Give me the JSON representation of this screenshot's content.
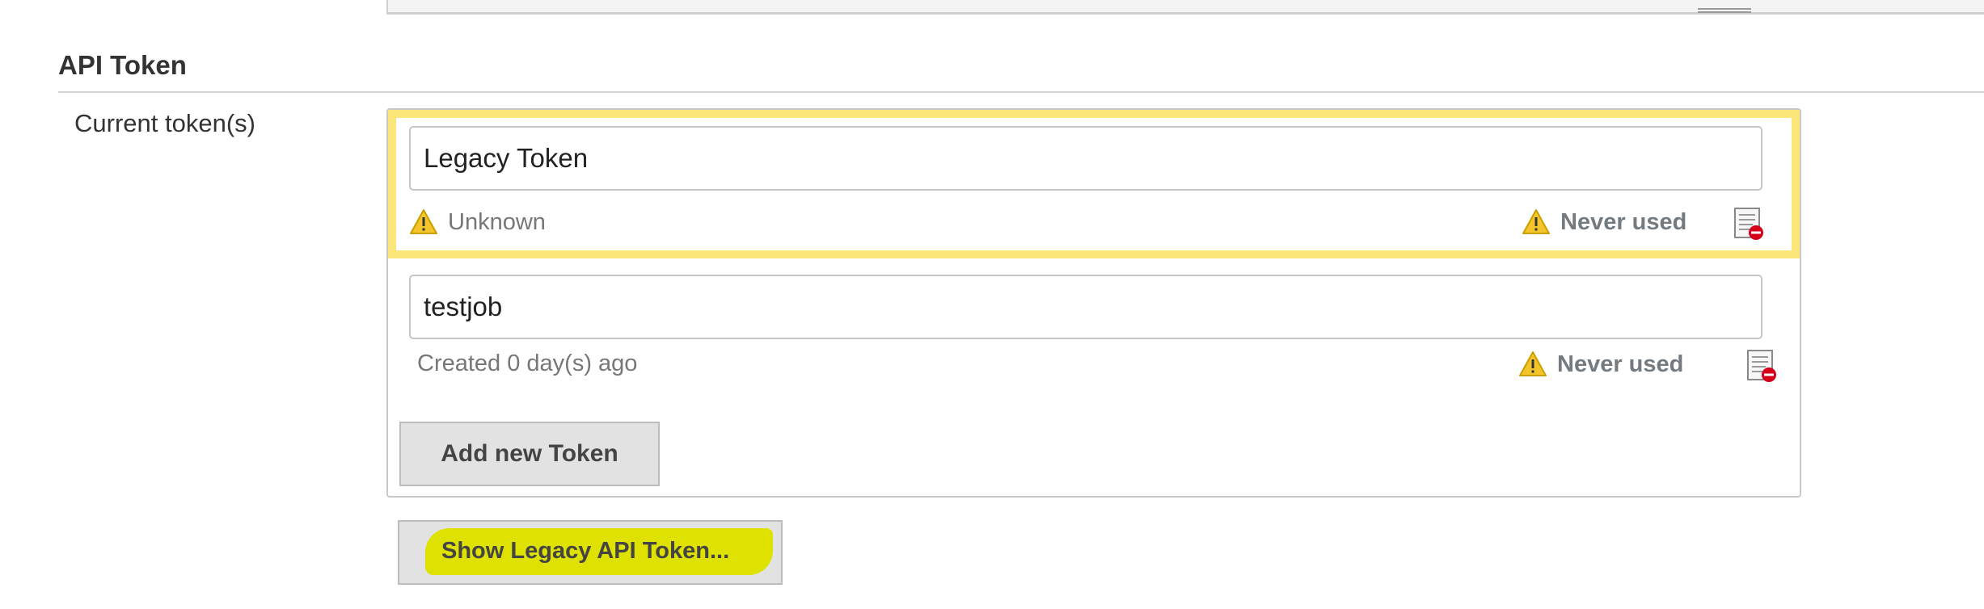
{
  "section": {
    "title": "API Token"
  },
  "field": {
    "label": "Current token(s)"
  },
  "tokens": [
    {
      "name": "Legacy Token",
      "status_text": "Unknown",
      "status_has_warning": true,
      "usage": "Never used",
      "highlighted": true,
      "highlight_color": "#fbe67a"
    },
    {
      "name": "testjob",
      "status_text": "Created 0 day(s) ago",
      "status_has_warning": false,
      "usage": "Never used",
      "highlighted": false
    }
  ],
  "buttons": {
    "add_new_token": "Add new Token",
    "show_legacy": "Show Legacy API Token..."
  },
  "icons": {
    "warning": "warning-triangle-icon",
    "revoke": "revoke-token-icon"
  },
  "colors": {
    "warning_fill": "#f3c52b",
    "revoke_red": "#d6001c",
    "marker_highlight": "#dfe100"
  }
}
